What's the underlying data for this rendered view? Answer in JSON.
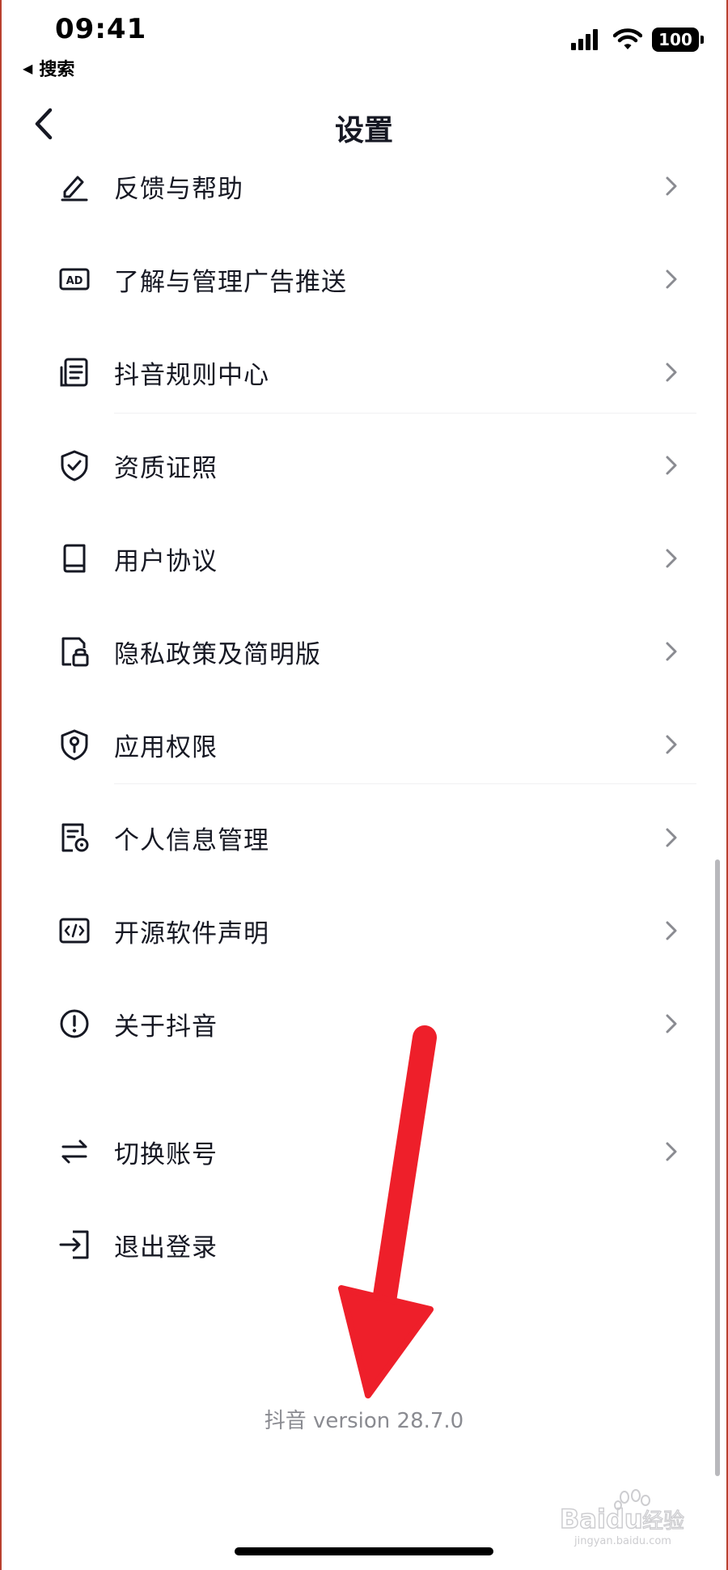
{
  "status_bar": {
    "time": "09:41",
    "back_to_app": "搜索",
    "battery": "100",
    "icons": [
      "signal-icon",
      "wifi-icon",
      "battery-icon"
    ]
  },
  "nav": {
    "title": "设置",
    "back_icon": "chevron-left-icon"
  },
  "settings": {
    "items": [
      {
        "label": "反馈与帮助",
        "icon": "edit-pen-icon"
      },
      {
        "label": "了解与管理广告推送",
        "icon": "ad-icon"
      },
      {
        "label": "抖音规则中心",
        "icon": "document-list-icon"
      },
      {
        "label": "资质证照",
        "icon": "shield-check-icon"
      },
      {
        "label": "用户协议",
        "icon": "book-icon"
      },
      {
        "label": "隐私政策及简明版",
        "icon": "document-lock-icon"
      },
      {
        "label": "应用权限",
        "icon": "shield-key-icon"
      },
      {
        "label": "个人信息管理",
        "icon": "document-gear-icon"
      },
      {
        "label": "开源软件声明",
        "icon": "code-icon"
      },
      {
        "label": "关于抖音",
        "icon": "info-circle-icon"
      },
      {
        "label": "切换账号",
        "icon": "switch-arrows-icon"
      },
      {
        "label": "退出登录",
        "icon": "logout-icon"
      }
    ]
  },
  "footer": {
    "version": "抖音 version 28.7.0"
  },
  "watermark": {
    "brand": "Baidu经验",
    "url": "jingyan.baidu.com"
  },
  "colors": {
    "text": "#161823",
    "muted": "#8a8b91",
    "annotation_arrow": "#ee1f2a"
  }
}
